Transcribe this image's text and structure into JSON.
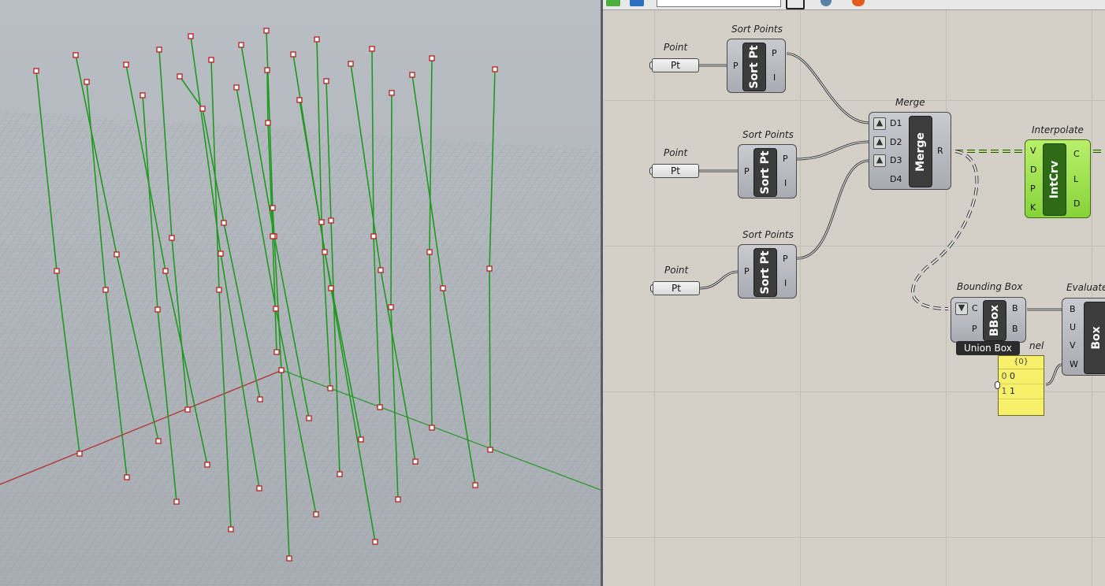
{
  "canvas": {
    "components": {
      "point1": {
        "title": "Point",
        "label": "Pt"
      },
      "point2": {
        "title": "Point",
        "label": "Pt"
      },
      "point3": {
        "title": "Point",
        "label": "Pt"
      },
      "sort1": {
        "title": "Sort Points",
        "core": "Sort Pt",
        "inputs": [
          "P"
        ],
        "outputs": [
          "P",
          "I"
        ]
      },
      "sort2": {
        "title": "Sort Points",
        "core": "Sort Pt",
        "inputs": [
          "P"
        ],
        "outputs": [
          "P",
          "I"
        ]
      },
      "sort3": {
        "title": "Sort Points",
        "core": "Sort Pt",
        "inputs": [
          "P"
        ],
        "outputs": [
          "P",
          "I"
        ]
      },
      "merge": {
        "title": "Merge",
        "core": "Merge",
        "inputs": [
          "D1",
          "D2",
          "D3",
          "D4"
        ],
        "outputs": [
          "R"
        ]
      },
      "interpolate": {
        "title": "Interpolate",
        "core": "IntCrv",
        "inputs": [
          "V",
          "D",
          "P",
          "K"
        ],
        "outputs": [
          "C",
          "L",
          "D"
        ]
      },
      "bbox": {
        "title": "Bounding Box",
        "core": "BBox",
        "inputs": [
          "C",
          "P"
        ],
        "outputs": [
          "B",
          "B"
        ]
      },
      "evaluate": {
        "title": "Evaluate",
        "core": "Box",
        "inputs": [
          "B",
          "U",
          "V",
          "W"
        ]
      },
      "panel": {
        "title": "nel",
        "header": "{0}",
        "rows": [
          {
            "index": "0",
            "value": "0"
          },
          {
            "index": "1",
            "value": "1"
          }
        ]
      }
    },
    "tooltip": "Union Box"
  },
  "icons": [
    "arrow-up-icon",
    "arrow-down-icon",
    "search-box"
  ],
  "colors": {
    "curve": "#1f9a1f",
    "canvas_bg": "#d4d0c8",
    "green_component": "#94dd45",
    "panel_yellow": "#f6f06a"
  }
}
